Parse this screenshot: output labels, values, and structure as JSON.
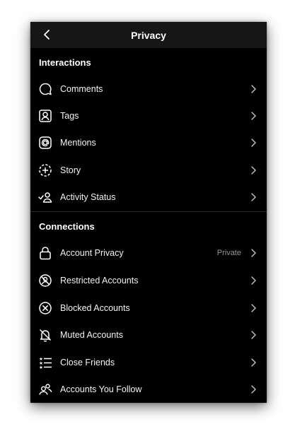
{
  "header": {
    "title": "Privacy"
  },
  "interactions": {
    "heading": "Interactions",
    "items": [
      {
        "label": "Comments",
        "icon": "comment-icon"
      },
      {
        "label": "Tags",
        "icon": "tag-icon"
      },
      {
        "label": "Mentions",
        "icon": "at-sign-icon"
      },
      {
        "label": "Story",
        "icon": "story-icon"
      },
      {
        "label": "Activity Status",
        "icon": "activity-status-icon"
      }
    ]
  },
  "connections": {
    "heading": "Connections",
    "items": [
      {
        "label": "Account Privacy",
        "value": "Private",
        "icon": "lock-icon"
      },
      {
        "label": "Restricted Accounts",
        "icon": "restricted-icon"
      },
      {
        "label": "Blocked Accounts",
        "icon": "blocked-icon"
      },
      {
        "label": "Muted Accounts",
        "icon": "muted-bell-icon"
      },
      {
        "label": "Close Friends",
        "icon": "close-friends-list-icon"
      },
      {
        "label": "Accounts You Follow",
        "icon": "following-icon"
      }
    ]
  },
  "colors": {
    "background": "#000000",
    "header": "#161616",
    "text": "#ffffff",
    "secondary": "#9a9a9a"
  }
}
